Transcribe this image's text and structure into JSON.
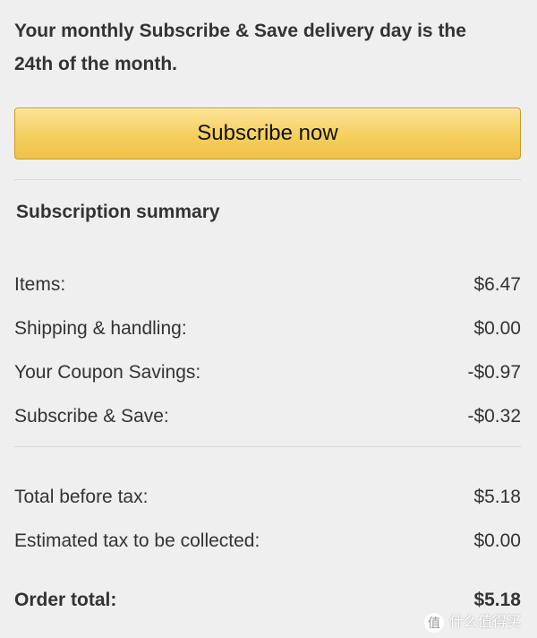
{
  "notice": {
    "line1": "Your monthly Subscribe & Save delivery day is the",
    "line2": "24th of the month."
  },
  "actions": {
    "subscribe_label": "Subscribe now"
  },
  "summary": {
    "title": "Subscription summary",
    "rows": [
      {
        "label": "Items:",
        "value": "$6.47"
      },
      {
        "label": "Shipping & handling:",
        "value": "$0.00"
      },
      {
        "label": "Your Coupon Savings:",
        "value": "-$0.97"
      },
      {
        "label": "Subscribe & Save:",
        "value": "-$0.32"
      }
    ],
    "totals": [
      {
        "label": "Total before tax:",
        "value": "$5.18"
      },
      {
        "label": "Estimated tax to be collected:",
        "value": "$0.00"
      }
    ],
    "order_total": {
      "label": "Order total:",
      "value": "$5.18"
    }
  },
  "watermark": {
    "icon_glyph": "值",
    "text": "什么值得买"
  },
  "colors": {
    "background": "#efefef",
    "button_top": "#fbe29a",
    "button_bottom": "#f0c14b",
    "button_border": "#c99b27",
    "text": "#333333"
  }
}
